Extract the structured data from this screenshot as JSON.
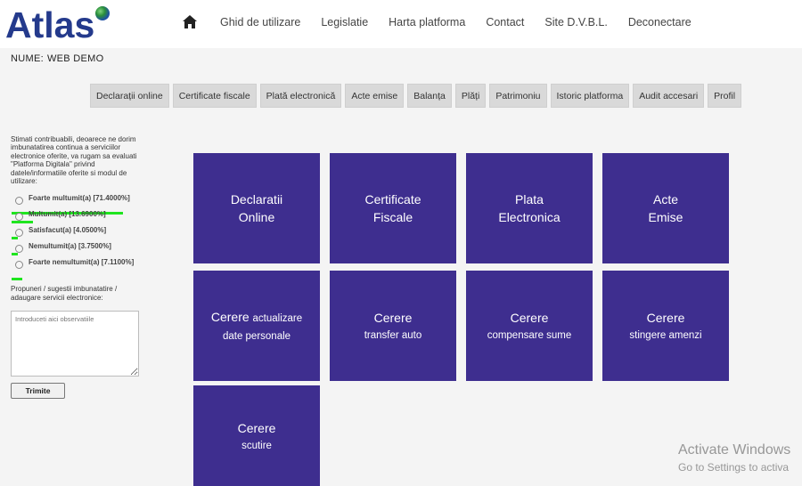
{
  "header": {
    "logo_text": "Atlas",
    "nav": [
      "Ghid de utilizare",
      "Legislatie",
      "Harta platforma",
      "Contact",
      "Site D.V.B.L.",
      "Deconectare"
    ]
  },
  "user": {
    "label": "NUME:",
    "name": "WEB DEMO"
  },
  "tabs": [
    "Declarații online",
    "Certificate fiscale",
    "Plată electronică",
    "Acte emise",
    "Balanța",
    "Plăți",
    "Patrimoniu",
    "Istoric platforma",
    "Audit accesari",
    "Profil"
  ],
  "sidebar": {
    "survey_text": "Stimati contribuabili, deoarece ne dorim imbunatatirea continua a serviciilor electronice oferite, va rugam sa evaluati \"Platforma Digitala\" privind datele/informatiile oferite si modul de utilizare:",
    "options": [
      {
        "label": "Foarte multumit(a) [71.4000%]",
        "percent": 71.4
      },
      {
        "label": "Multumit(a) [13.6900%]",
        "percent": 13.69
      },
      {
        "label": "Satisfacut(a) [4.0500%]",
        "percent": 4.05
      },
      {
        "label": "Nemultumit(a) [3.7500%]",
        "percent": 3.75
      },
      {
        "label": "Foarte nemultumit(a) [7.1100%]",
        "percent": 7.11
      }
    ],
    "proposal_text": "Propuneri / sugestii imbunatatire / adaugare servicii electronice:",
    "textarea_placeholder": "Introduceti aici observatiile",
    "submit_label": "Trimite",
    "bar_color": "#1fe51f"
  },
  "tiles": [
    {
      "line1": "Declaratii",
      "line2": "Online"
    },
    {
      "line1": "Certificate",
      "line2": "Fiscale"
    },
    {
      "line1": "Plata",
      "line2": "Electronica"
    },
    {
      "line1": "Acte",
      "line2": "Emise"
    },
    {
      "line1": "Cerere",
      "line1_small": "actualizare",
      "line2": "date personale"
    },
    {
      "line1": "Cerere",
      "line2": "transfer auto"
    },
    {
      "line1": "Cerere",
      "line2": "compensare sume"
    },
    {
      "line1": "Cerere",
      "line2": "stingere amenzi"
    },
    {
      "line1": "Cerere",
      "line2": "scutire"
    }
  ],
  "tile_color": "#3e2e8f",
  "watermark": {
    "line1": "Activate Windows",
    "line2": "Go to Settings to activa"
  }
}
